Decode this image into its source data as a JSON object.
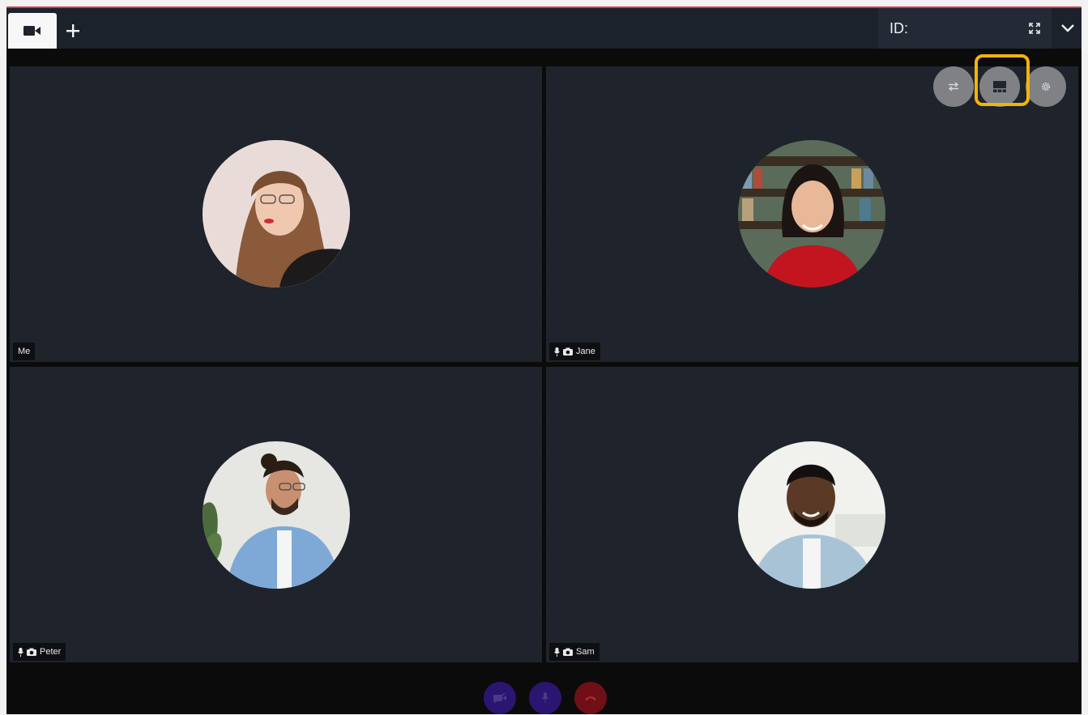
{
  "topbar": {
    "tabs": [
      {
        "icon": "video-camera-icon",
        "active": true
      }
    ],
    "add_tab_icon": "plus-icon",
    "id_label": "ID:",
    "expand_icon": "expand-arrows-icon",
    "menu_icon": "chevron-down-icon"
  },
  "controls": {
    "swap_icon": "swap-arrows-icon",
    "layout_icon": "layout-grid-icon",
    "settings_icon": "gear-icon",
    "highlight_color": "#f4b30a"
  },
  "participants": [
    {
      "name": "Me",
      "mic_icon": false,
      "camera_icon": false
    },
    {
      "name": "Jane",
      "mic_icon": true,
      "camera_icon": true
    },
    {
      "name": "Peter",
      "mic_icon": true,
      "camera_icon": true
    },
    {
      "name": "Sam",
      "mic_icon": true,
      "camera_icon": true
    }
  ],
  "bottom_controls": [
    {
      "icon": "video-off-icon",
      "color": "#2a1670"
    },
    {
      "icon": "microphone-icon",
      "color": "#2a1670"
    },
    {
      "icon": "hang-up-icon",
      "color": "#6f1016"
    }
  ],
  "colors": {
    "topbar": "#1c222c",
    "tile": "#1d222b",
    "top_border": "#c9424a"
  }
}
